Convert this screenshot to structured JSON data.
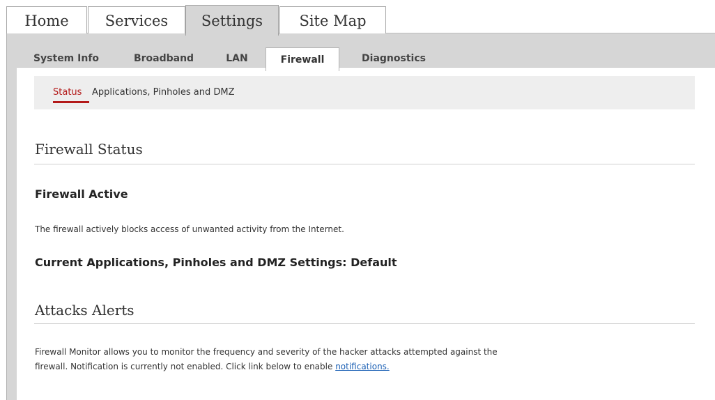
{
  "top_tabs": [
    {
      "label": "Home",
      "active": false
    },
    {
      "label": "Services",
      "active": false
    },
    {
      "label": "Settings",
      "active": true
    },
    {
      "label": "Site Map",
      "active": false
    }
  ],
  "sub_tabs": [
    {
      "label": "System Info",
      "active": false
    },
    {
      "label": "Broadband",
      "active": false
    },
    {
      "label": "LAN",
      "active": false
    },
    {
      "label": "Firewall",
      "active": true
    },
    {
      "label": "Diagnostics",
      "active": false
    }
  ],
  "subnav": {
    "status_label": "Status",
    "apps_label": "Applications, Pinholes and DMZ"
  },
  "firewall_status": {
    "title": "Firewall Status",
    "state": "Firewall Active",
    "description": "The firewall actively blocks access of unwanted activity from the Internet.",
    "current_settings": "Current Applications, Pinholes and DMZ Settings: Default"
  },
  "attacks_alerts": {
    "title": "Attacks Alerts",
    "line1": "Firewall Monitor allows you to monitor the frequency and severity of the hacker attacks attempted against the",
    "line2_prefix": "firewall. Notification is currently not enabled. Click link below to enable ",
    "link_label": "notifications."
  },
  "colors": {
    "accent_red": "#b31919",
    "link_blue": "#1a5fb4",
    "panel_gray": "#d6d6d6"
  }
}
